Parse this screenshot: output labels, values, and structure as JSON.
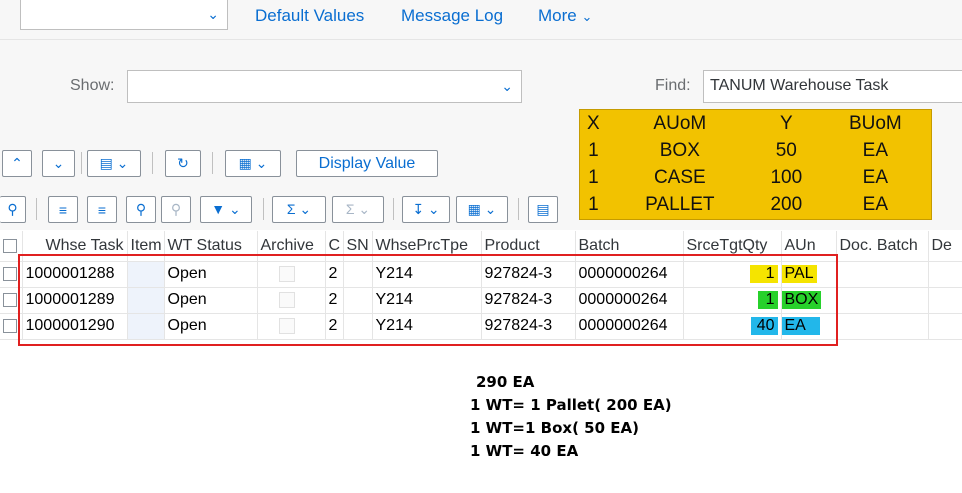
{
  "toolbar": {
    "links": [
      "Default Values",
      "Message Log",
      "More"
    ]
  },
  "filter": {
    "show_label": "Show:",
    "show_value": "",
    "find_label": "Find:",
    "find_value": "TANUM Warehouse Task"
  },
  "actions": {
    "display_value_label": "Display Value"
  },
  "legend": {
    "headers": [
      "X",
      "AUoM",
      "Y",
      "BUoM"
    ],
    "rows": [
      [
        "1",
        "BOX",
        "50",
        "EA"
      ],
      [
        "1",
        "CASE",
        "100",
        "EA"
      ],
      [
        "1",
        "PALLET",
        "200",
        "EA"
      ]
    ]
  },
  "table": {
    "columns": [
      "Whse Task",
      "Item",
      "WT Status",
      "Archive",
      "C",
      "SN",
      "WhsePrcTpe",
      "Product",
      "Batch",
      "SrceTgtQty",
      "AUn",
      "Doc. Batch",
      "De"
    ],
    "rows": [
      {
        "whse_task": "1000001288",
        "item": "",
        "status": "Open",
        "c": "2",
        "sn": "",
        "proc": "Y214",
        "product": "927824-3",
        "batch": "0000000264",
        "qty": "1",
        "aun": "PAL"
      },
      {
        "whse_task": "1000001289",
        "item": "",
        "status": "Open",
        "c": "2",
        "sn": "",
        "proc": "Y214",
        "product": "927824-3",
        "batch": "0000000264",
        "qty": "1",
        "aun": "BOX"
      },
      {
        "whse_task": "1000001290",
        "item": "",
        "status": "Open",
        "c": "2",
        "sn": "",
        "proc": "Y214",
        "product": "927824-3",
        "batch": "0000000264",
        "qty": "40",
        "aun": "EA"
      }
    ],
    "highlight_colors": [
      "#f5e400",
      "#27d12b",
      "#22b7ea"
    ]
  },
  "note": {
    "lines": [
      "290 EA",
      "1 WT= 1 Pallet( 200 EA)",
      "1 WT=1 Box( 50 EA)",
      "1 WT= 40 EA"
    ]
  },
  "colors": {
    "accent": "#0a6ed1",
    "legend_bg": "#f2c200",
    "selection_border": "#e02020"
  }
}
